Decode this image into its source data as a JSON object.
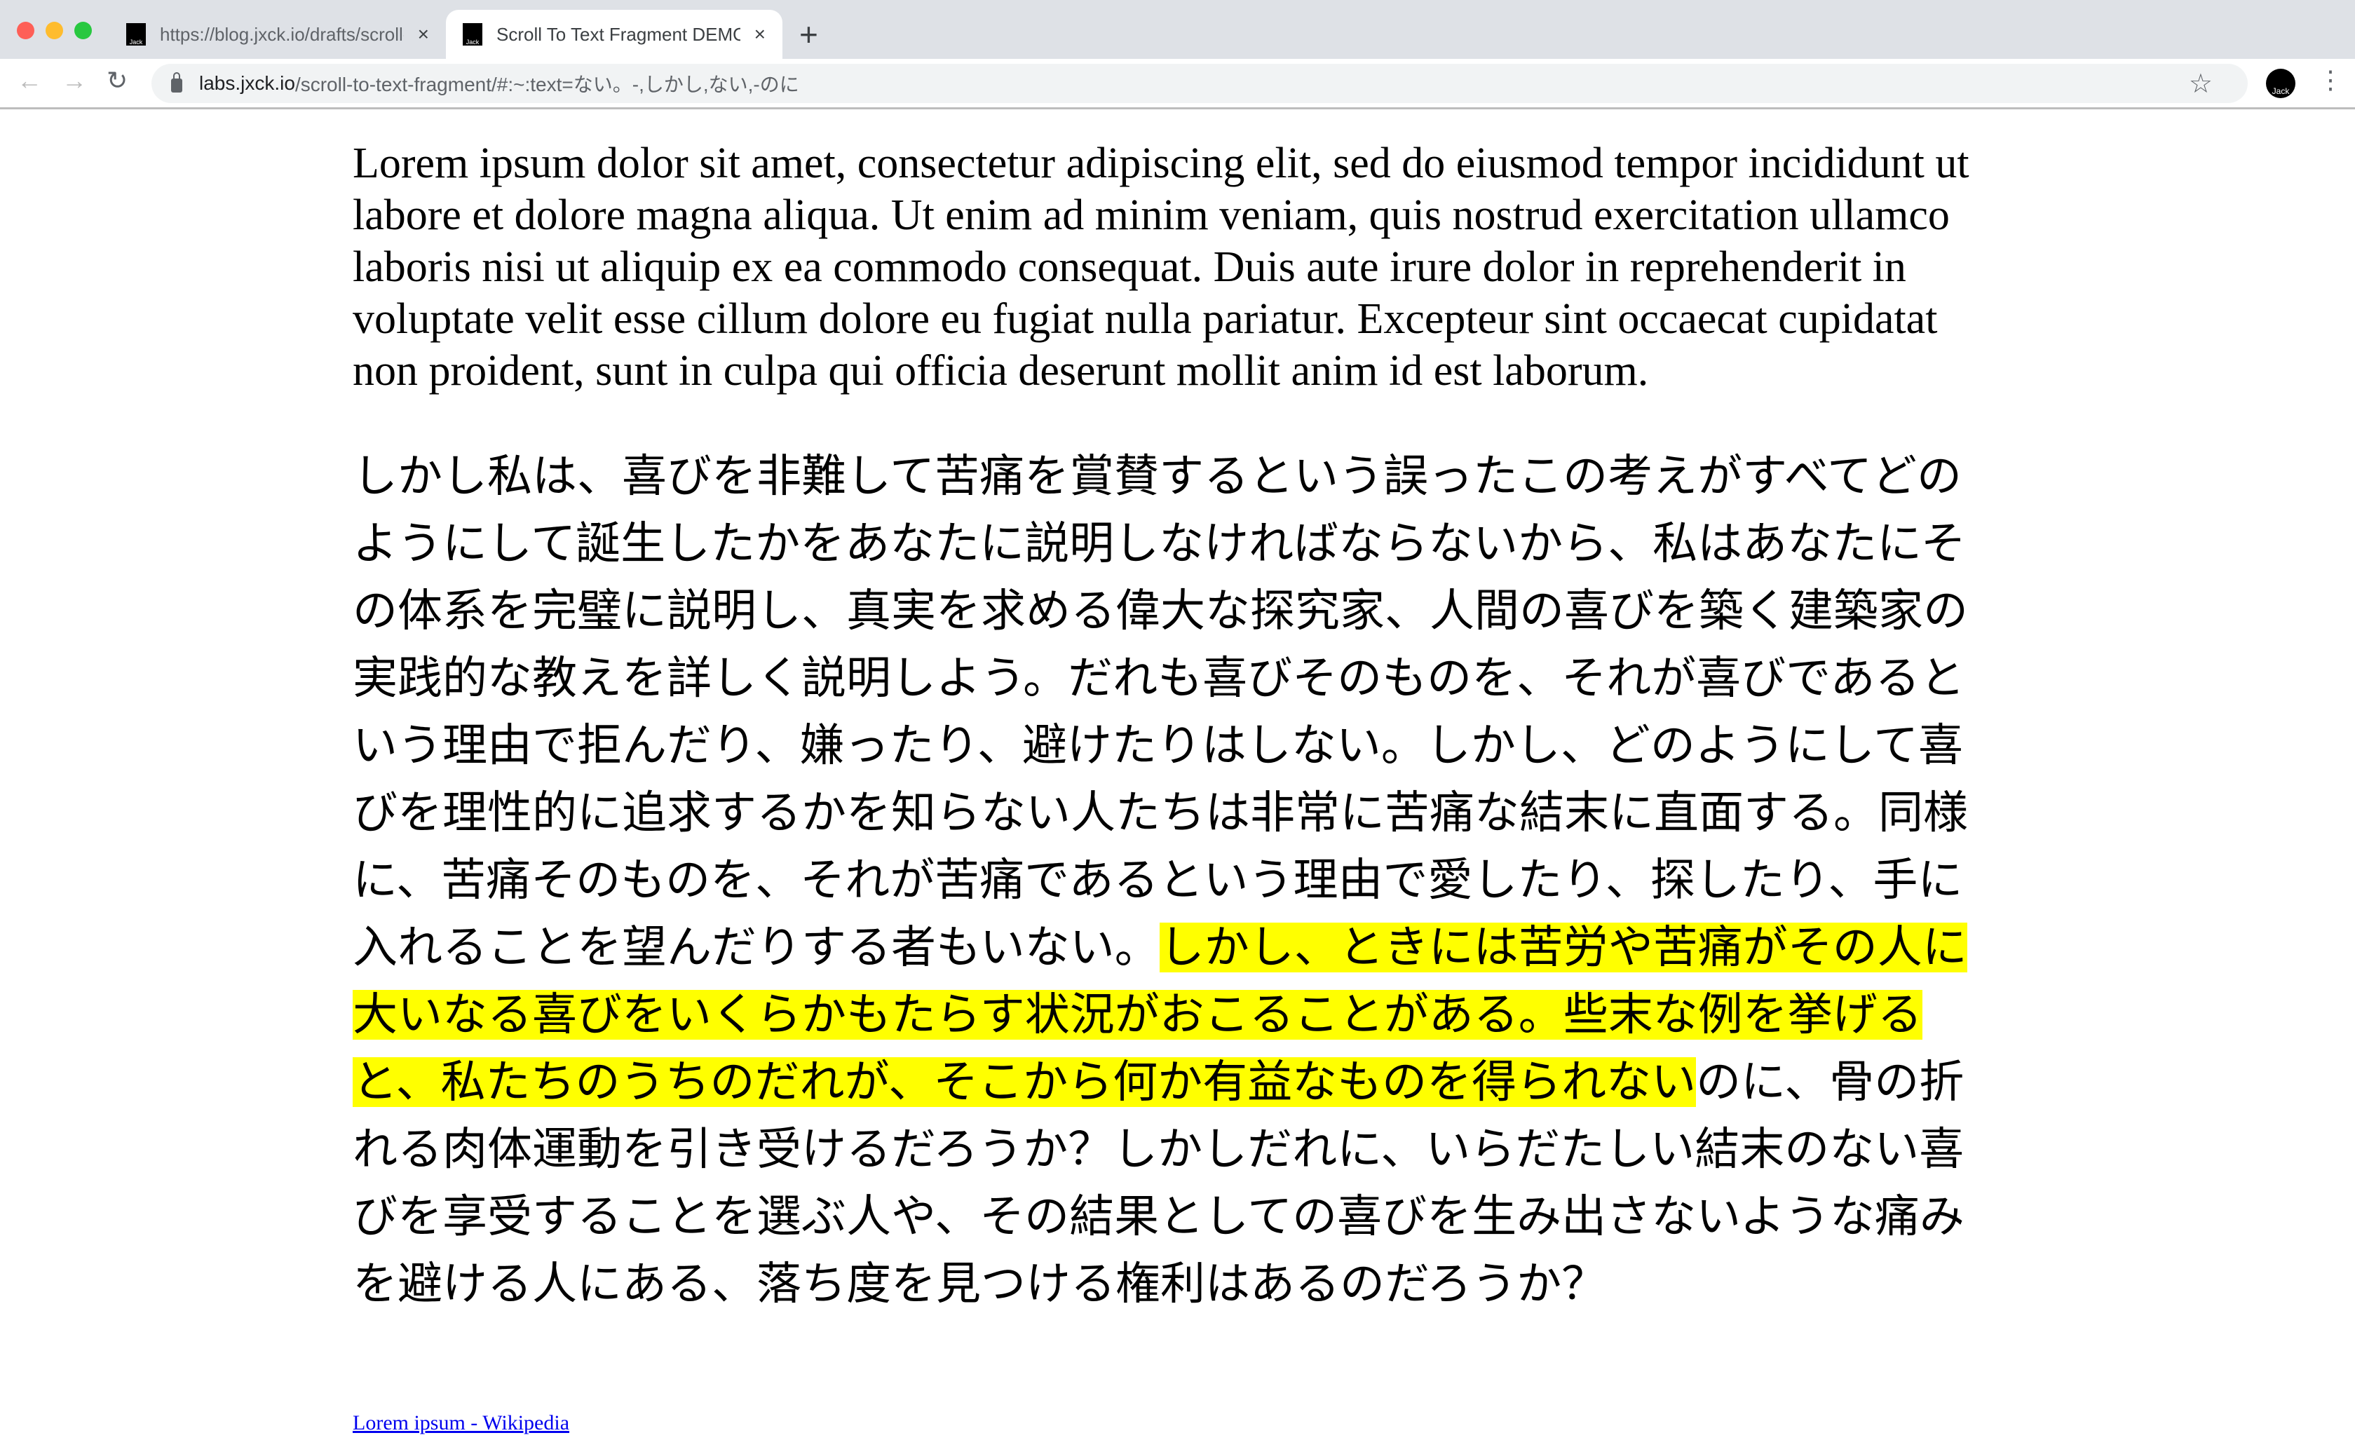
{
  "browser": {
    "tabs": [
      {
        "title": "https://blog.jxck.io/drafts/scroll-to-text-fragment",
        "favicon": "Jack",
        "active": false
      },
      {
        "title": "Scroll To Text Fragment DEMO",
        "favicon": "Jack",
        "active": true
      }
    ],
    "new_tab": "+",
    "close_glyph": "×",
    "url_host": "labs.jxck.io",
    "url_path": "/scroll-to-text-fragment/#:~:text=ない。-,しかし,ない,-のに",
    "avatar_label": "Jack",
    "icons": [
      "back-icon",
      "forward-icon",
      "reload-icon",
      "lock-icon",
      "star-icon",
      "menu-icon"
    ]
  },
  "page": {
    "paragraph_en": "Lorem ipsum dolor sit amet, consectetur adipiscing elit, sed do eiusmod tempor incididunt ut labore et dolore magna aliqua. Ut enim ad minim veniam, quis nostrud exercitation ullamco laboris nisi ut aliquip ex ea commodo consequat. Duis aute irure dolor in reprehenderit in voluptate velit esse cillum dolore eu fugiat nulla pariatur. Excepteur sint occaecat cupidatat non proident, sunt in culpa qui officia deserunt mollit anim id est laborum.",
    "paragraph_ja_before": "しかし私は、喜びを非難して苦痛を賞賛するという誤ったこの考えがすべてどのようにして誕生したかをあなたに説明しなければならないから、私はあなたにその体系を完璧に説明し、真実を求める偉大な探究家、人間の喜びを築く建築家の実践的な教えを詳しく説明しよう。だれも喜びそのものを、それが喜びであるという理由で拒んだり、嫌ったり、避けたりはしない。しかし、どのようにして喜びを理性的に追求するかを知らない人たちは非常に苦痛な結末に直面する。同様に、苦痛そのものを、それが苦痛であるという理由で愛したり、探したり、手に入れることを望んだりする者もいない。",
    "paragraph_ja_highlight": "しかし、ときには苦労や苦痛がその人に大いなる喜びをいくらかもたらす状況がおこることがある。些末な例を挙げると、私たちのうちのだれが、そこから何か有益なものを得られない",
    "paragraph_ja_after": "のに、骨の折れる肉体運動を引き受けるだろうか？しかしだれに、いらだたしい結末のない喜びを享受することを選ぶ人や、その結果としての喜びを生み出さないような痛みを避ける人にある、落ち度を見つける権利はあるのだろうか？",
    "link": "Lorem ipsum - Wikipedia",
    "highlight_color": "#ffff00",
    "link_color": "#0000ee"
  }
}
